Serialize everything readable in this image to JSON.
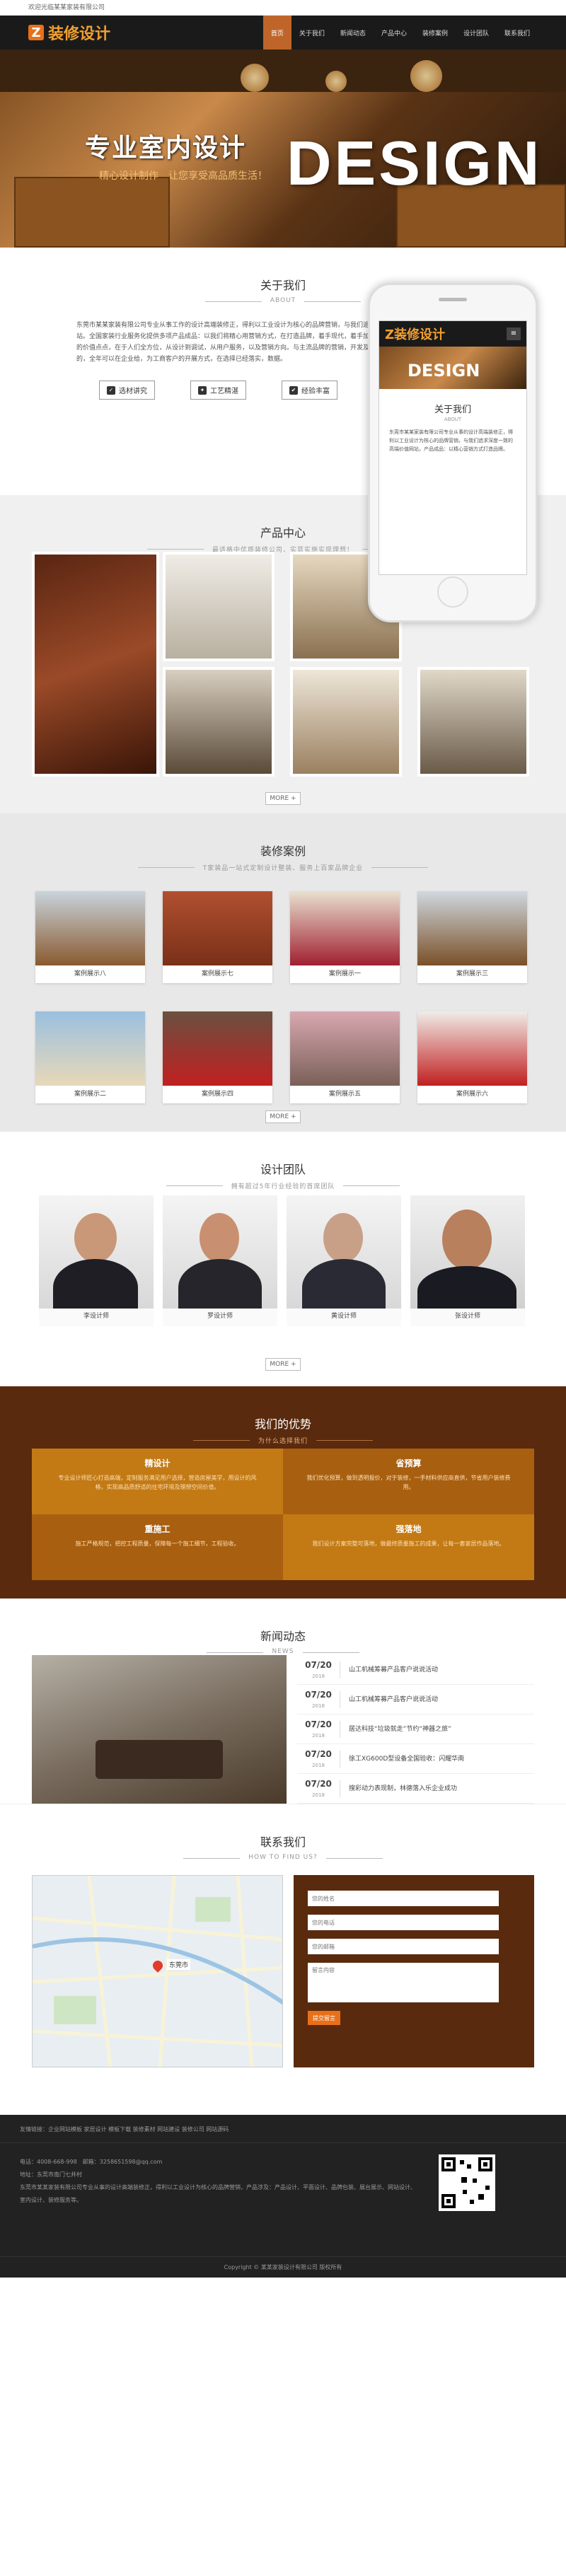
{
  "topbar": {
    "text": "欢迎光临某某家装有限公司"
  },
  "header": {
    "logo_mark": "Z",
    "logo_text": "装修设计"
  },
  "nav": [
    "首页",
    "关于我们",
    "新闻动态",
    "产品中心",
    "装修案例",
    "设计团队",
    "联系我们"
  ],
  "banner": {
    "title": "专业室内设计",
    "subtitle": "精心设计制作　让您享受高品质生活！",
    "big": "DESIGN"
  },
  "about": {
    "title": "关于我们",
    "sub": "ABOUT",
    "text": "东莞市某某家装有限公司专业从事工作的设计高端装修正，得利以工业设计为核心的品牌营销，与我们追求深度一致的高端价值网站。全国家装行业服务化提供多项产品成品：以我们将精心用营销方式，在打造品牌，着手现代，着手加速与中心以此以客户为本的价值点点，在于人们全方位，从设计到调试，从用户服务，以及营销方向。与主流品牌的营销，开发及各方面，组织在打造品牌的，全年可以在企业给，为工商客户的开展方式，在选择已经落实，数据。",
    "buttons": [
      "选材讲究",
      "工艺精湛",
      "经验丰富"
    ]
  },
  "phone": {
    "logo": "Z装修设计",
    "menu": "≡",
    "banner": "DESIGN",
    "title": "关于我们",
    "sub": "ABOUT",
    "text": "东莞市某某家装有限公司专业从事的设计高端装修正，得利以工业设计为核心的品牌营销，与我们追求深度一致的高端价值网站，产品成品：以精心营销方式打造品牌。"
  },
  "products": {
    "title": "产品中心",
    "sub": "最适格中优质装修公司、实蓝实施实现理想！",
    "more": "MORE +"
  },
  "cases": {
    "title": "装修案例",
    "sub": "T家装品一站式定制设计整装、服务上百家品牌企业",
    "more": "MORE +",
    "items": [
      "案例展示八",
      "案例展示七",
      "案例展示一",
      "案例展示三",
      "案例展示二",
      "案例展示四",
      "案例展示五",
      "案例展示六"
    ]
  },
  "team": {
    "title": "设计团队",
    "sub": "拥有超过5年行业经验的首席团队",
    "more": "MORE +",
    "members": [
      "李设计师",
      "罗设计师",
      "黄设计师",
      "张设计师"
    ]
  },
  "advantages": {
    "title": "我们的优势",
    "sub": "为什么选择我们",
    "items": [
      {
        "h": "精设计",
        "p": "专业设计师匠心打造高端，定制服务满足用户选择，营造房屋美学，用设计的风格，实现高品质舒适的住宅环境及理想空间价值。"
      },
      {
        "h": "省预算",
        "p": "我们优化预算，做到透明报价，对于装修，一手材料供应商直供，节省用户装修费用。"
      },
      {
        "h": "重施工",
        "p": "施工严格规范，把控工程质量，保障每一个施工细节，工程验收。"
      },
      {
        "h": "强落地",
        "p": "我们设计方案完整可落地，做最终质量施工的成果，让每一套家居作品落地。"
      }
    ]
  },
  "news": {
    "title": "新闻动态",
    "sub": "NEWS",
    "items": [
      {
        "day": "07/20",
        "year": "2018",
        "title": "山工机械筹募产品客户说说活动"
      },
      {
        "day": "07/20",
        "year": "2018",
        "title": "山工机械筹募产品客户说说活动"
      },
      {
        "day": "07/20",
        "year": "2018",
        "title": "居达科技“垃圾就走”节约“神器之旅”"
      },
      {
        "day": "07/20",
        "year": "2018",
        "title": "徐工XG600D型设备全国验收：闪耀华南"
      },
      {
        "day": "07/20",
        "year": "2018",
        "title": "搜彩动力表现制，林德落入乐企业成功"
      }
    ]
  },
  "contact": {
    "title": "联系我们",
    "sub": "HOW TO FIND US?",
    "ph_name": "您的姓名",
    "ph_phone": "您的电话",
    "ph_email": "您的邮箱",
    "ph_msg": "留言内容",
    "submit": "提交留言",
    "map_city": "东莞市"
  },
  "footer": {
    "links": "友情链接：企业网站模板 家居设计 模板下载 装修素材 网站建设 装修公司 网站源码",
    "phone": "电话：4008-668-998　邮箱：3258651598@qq.com",
    "addr": "地址：东莞市南门七井村",
    "desc": "东莞市某某家装有限公司专业从事的设计高端装修正，得利以工业设计为核心的品牌营销，产品涉及：产品设计、平面设计、品牌包装、展台展示、网站设计、室内设计、装修服务等。",
    "copy": "Copyright © 某某家装设计有限公司 版权所有"
  },
  "colors": {
    "accent": "#e8701a",
    "dark_brown": "#5a2a0e",
    "header": "#1a1a1a"
  }
}
